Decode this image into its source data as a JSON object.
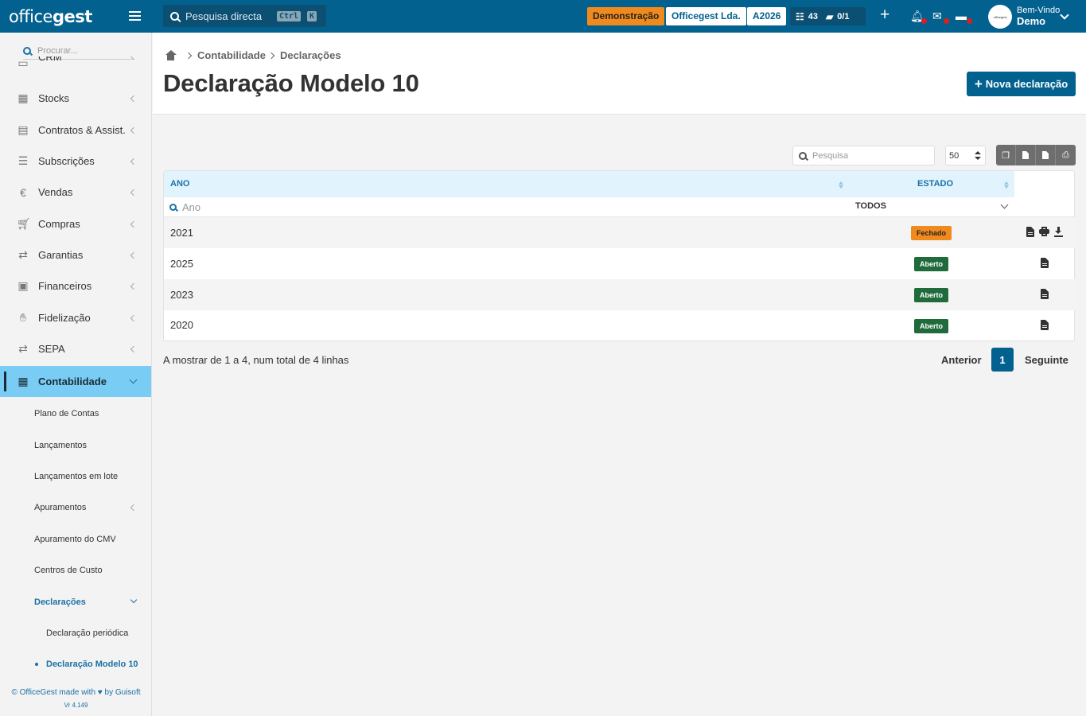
{
  "topbar": {
    "logo_office": "office",
    "logo_gest": "gest",
    "search_placeholder": "Pesquisa directa",
    "shortcut_ctrl": "Ctrl",
    "shortcut_key": "K",
    "mode_badge": "Demonstração",
    "company": "Officegest Lda.",
    "fiscal_year": "A2026",
    "tasks_count": "43",
    "docs_count": "0/1",
    "greeting": "Bem-Vindo",
    "user_name": "Demo",
    "avatar_text": "officegest"
  },
  "sidebar": {
    "search_placeholder": "Procurar...",
    "items": [
      {
        "label": "CRM",
        "icon": "crm-icon"
      },
      {
        "label": "Stocks",
        "icon": "warehouse-icon"
      },
      {
        "label": "Contratos & Assist.",
        "icon": "contract-icon"
      },
      {
        "label": "Subscrições",
        "icon": "list-icon"
      },
      {
        "label": "Vendas",
        "icon": "euro-icon"
      },
      {
        "label": "Compras",
        "icon": "cart-icon"
      },
      {
        "label": "Garantias",
        "icon": "exchange-icon"
      },
      {
        "label": "Financeiros",
        "icon": "money-icon"
      },
      {
        "label": "Fidelização",
        "icon": "hand-icon"
      },
      {
        "label": "SEPA",
        "icon": "exchange-icon"
      },
      {
        "label": "Contabilidade",
        "icon": "calculator-icon"
      }
    ],
    "sub_items": [
      {
        "label": "Plano de Contas"
      },
      {
        "label": "Lançamentos"
      },
      {
        "label": "Lançamentos em lote"
      },
      {
        "label": "Apuramentos"
      },
      {
        "label": "Apuramento do CMV"
      },
      {
        "label": "Centros de Custo"
      },
      {
        "label": "Declarações"
      },
      {
        "label": "Declaração periódica"
      },
      {
        "label": "Declaração Modelo 10"
      }
    ],
    "footer_left": "© OfficeGest made with",
    "footer_right": "by Guisoft",
    "version": "Vr 4.149"
  },
  "breadcrumb": [
    "Contabilidade",
    "Declarações"
  ],
  "page": {
    "title": "Declaração Modelo 10",
    "new_button": "Nova declaração"
  },
  "table_tools": {
    "search_placeholder": "Pesquisa",
    "page_size": "50"
  },
  "table": {
    "col_year": "ANO",
    "col_status": "ESTADO",
    "filter_year_placeholder": "Ano",
    "filter_status": "TODOS",
    "rows": [
      {
        "year": "2021",
        "status": "Fechado"
      },
      {
        "year": "2025",
        "status": "Aberto"
      },
      {
        "year": "2023",
        "status": "Aberto"
      },
      {
        "year": "2020",
        "status": "Aberto"
      }
    ]
  },
  "footer": {
    "summary": "A mostrar de 1 a 4, num total de 4 linhas",
    "prev": "Anterior",
    "current_page": "1",
    "next": "Seguinte"
  },
  "colors": {
    "topbar": "#03618f",
    "active_sidebar": "#79cdf4",
    "closed_badge": "#f08a1c",
    "open_badge": "#1f6b3c"
  }
}
